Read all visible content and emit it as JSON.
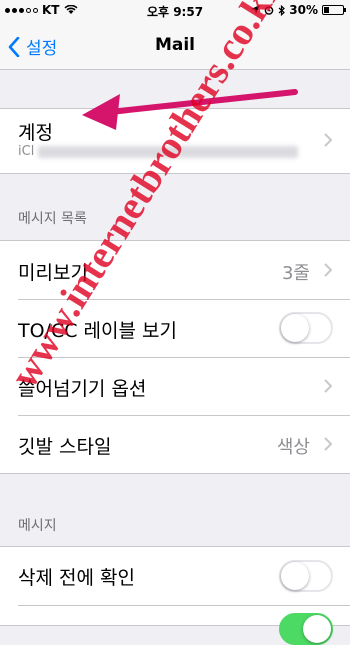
{
  "status_bar": {
    "carrier": "KT",
    "time": "오후 9:57",
    "battery": "30%",
    "battery_level": 0.3,
    "icons": [
      "signal-dots",
      "wifi-icon",
      "location-icon",
      "alarm-icon",
      "bluetooth-icon",
      "battery-icon"
    ]
  },
  "nav": {
    "back_label": "설정",
    "title": "Mail"
  },
  "accounts_row": {
    "label": "계정",
    "detail_prefix": "iCl"
  },
  "section_message_list": {
    "header": "메시지 목록",
    "rows": [
      {
        "label": "미리보기",
        "value": "3줄"
      },
      {
        "label": "TO/CC 레이블 보기",
        "toggle": false
      },
      {
        "label": "쓸어넘기기 옵션"
      },
      {
        "label": "깃발 스타일",
        "value": "색상"
      }
    ]
  },
  "section_messages": {
    "header": "메시지",
    "rows": [
      {
        "label": "삭제 전에 확인",
        "toggle": false
      }
    ]
  },
  "watermark": "www.internetbrothers.co.kr",
  "colors": {
    "accent": "#007aff",
    "background": "#efeff4",
    "toggle_on": "#4cd964",
    "watermark": "#e00020",
    "arrow": "#d4156b"
  }
}
